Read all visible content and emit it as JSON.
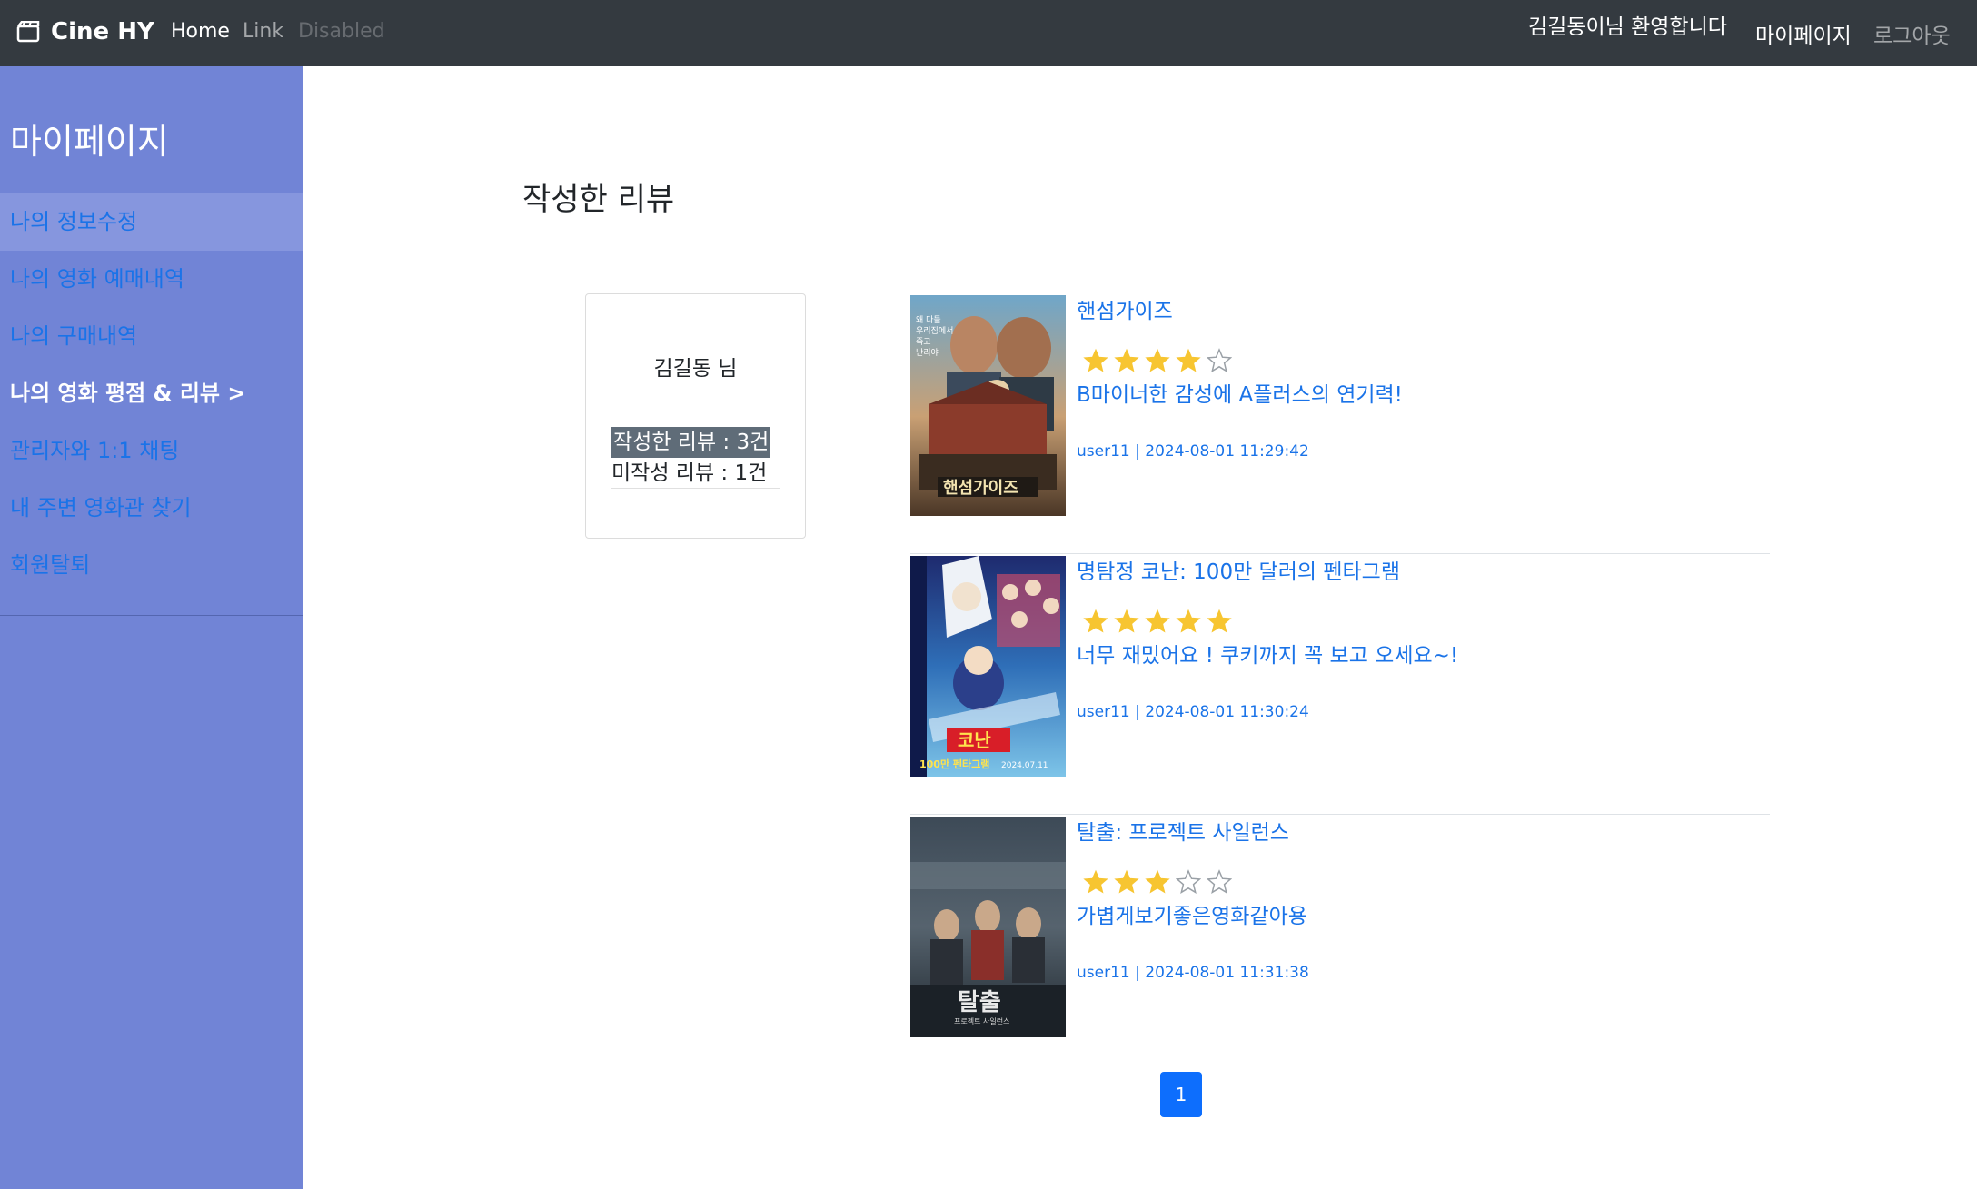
{
  "navbar": {
    "brand": "Cine HY",
    "brand_icon": "film-icon",
    "links": {
      "home": "Home",
      "link": "Link",
      "disabled": "Disabled"
    },
    "welcome": "김길동이님 환영합니다",
    "mypage": "마이페이지",
    "logout": "로그아웃"
  },
  "sidebar": {
    "title": "마이페이지",
    "items": [
      {
        "label": "나의 정보수정"
      },
      {
        "label": "나의 영화 예매내역"
      },
      {
        "label": "나의 구매내역"
      },
      {
        "label": "나의 영화 평점 & 리뷰 >"
      },
      {
        "label": "관리자와 1:1 채팅"
      },
      {
        "label": "내 주변 영화관 찾기"
      },
      {
        "label": "회원탈퇴"
      }
    ]
  },
  "main": {
    "heading": "작성한 리뷰",
    "profile": {
      "name": "김길동 님",
      "review_count": "작성한 리뷰 : 3건",
      "unwritten_count": "미작성 리뷰 : 1건"
    },
    "reviews": [
      {
        "title": "핸섬가이즈",
        "rating": 4,
        "max": 5,
        "text": "B마이너한 감성에 A플러스의 연기력!",
        "meta": "user11 | 2024-08-01 11:29:42",
        "poster": "poster-handsome-guys"
      },
      {
        "title": "명탐정 코난: 100만 달러의 펜타그램",
        "rating": 5,
        "max": 5,
        "text": "너무 재밌어요 ! 쿠키까지 꼭 보고 오세요~!",
        "meta": "user11 | 2024-08-01 11:30:24",
        "poster": "poster-conan"
      },
      {
        "title": "탈출: 프로젝트 사일런스",
        "rating": 3,
        "max": 5,
        "text": "가볍게보기좋은영화같아용",
        "meta": "user11 | 2024-08-01 11:31:38",
        "poster": "poster-escape"
      }
    ],
    "pagination": {
      "current": "1"
    }
  },
  "colors": {
    "navbar": "#343a40",
    "sidebar": "#7184d6",
    "link": "#1a73e8",
    "star": "#f7c531",
    "primary": "#0d6efd"
  }
}
